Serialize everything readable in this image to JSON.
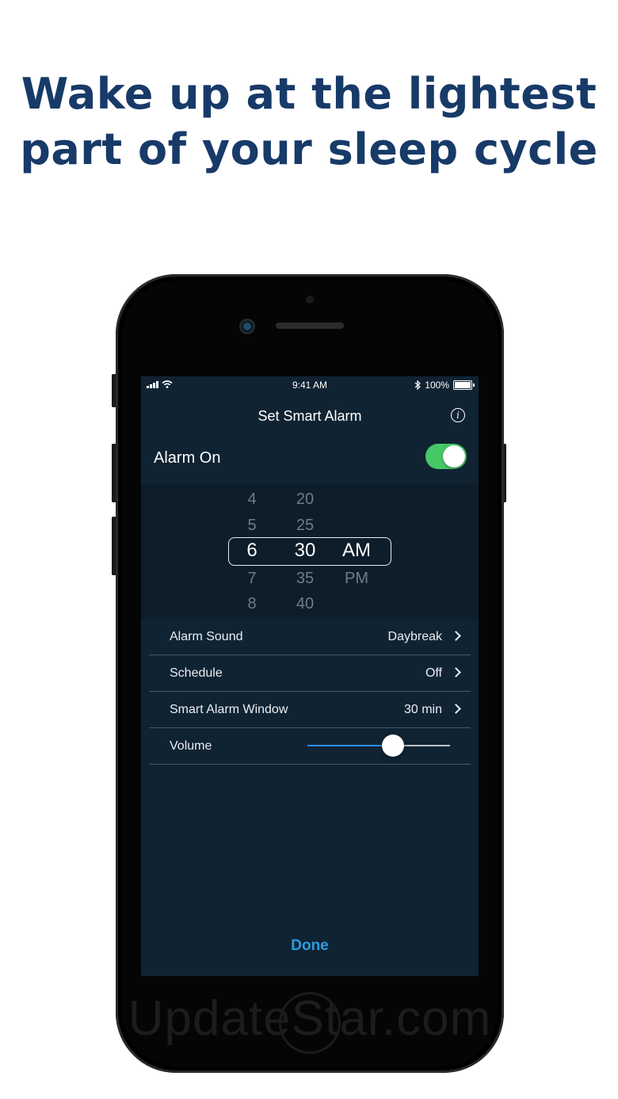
{
  "headline": {
    "line1": "Wake up at the lightest",
    "line2": "part of your sleep cycle"
  },
  "watermark": "UpdateStar.com",
  "status_bar": {
    "time": "9:41 AM",
    "battery": "100%",
    "icons": [
      "signal-icon",
      "wifi-icon",
      "bluetooth-icon",
      "battery-icon"
    ]
  },
  "screen": {
    "title": "Set Smart Alarm",
    "info_icon": "ⓘ",
    "alarm_label": "Alarm On",
    "alarm_on": true,
    "picker": {
      "hours": [
        "4",
        "5",
        "6",
        "7",
        "8"
      ],
      "minutes": [
        "20",
        "25",
        "30",
        "35",
        "40"
      ],
      "periods": [
        "AM",
        "PM"
      ],
      "selected_hour": "6",
      "selected_minute": "30",
      "selected_period": "AM"
    },
    "settings": [
      {
        "label": "Alarm Sound",
        "value": "Daybreak"
      },
      {
        "label": "Schedule",
        "value": "Off"
      },
      {
        "label": "Smart Alarm Window",
        "value": "30 min"
      }
    ],
    "volume": {
      "label": "Volume",
      "level": 0.6
    },
    "done_label": "Done"
  },
  "colors": {
    "headline": "#173a68",
    "screen_bg": "#102333",
    "toggle_on": "#46c867",
    "accent": "#2d9ce0"
  }
}
